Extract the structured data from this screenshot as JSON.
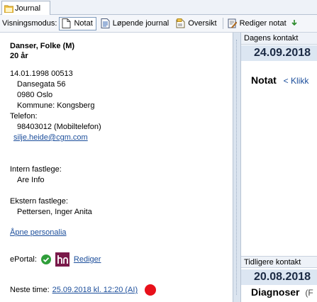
{
  "tab": {
    "label": "Journal",
    "icon": "journal-folder-icon"
  },
  "toolbar": {
    "label": "Visningsmodus:",
    "buttons": [
      {
        "label": "Notat",
        "icon": "document-icon",
        "active": true
      },
      {
        "label": "Løpende journal",
        "icon": "list-document-icon"
      },
      {
        "label": "Oversikt",
        "icon": "overview-icon"
      },
      {
        "label": "Rediger notat",
        "icon": "edit-note-icon"
      }
    ]
  },
  "patient": {
    "name": "Danser, Folke (M)",
    "age": "20 år",
    "birth": "14.01.1998 00513",
    "street": "Dansegata 56",
    "postal": "0980 Oslo",
    "municipality": "Kommune: Kongsberg",
    "phone_label": "Telefon:",
    "phone": "98403012 (Mobiltelefon)",
    "email": "silje.heide@cgm.com",
    "internal_gp_label": "Intern fastlege:",
    "internal_gp": "Are Info",
    "external_gp_label": "Ekstern fastlege:",
    "external_gp": "Pettersen, Inger Anita",
    "open_personalia": "Åpne personalia",
    "eportal_label": "ePortal:",
    "eportal_edit": "Rediger",
    "next_time_label": "Neste time:",
    "next_time": "25.09.2018 kl. 12:20 (AI)",
    "status_color": "#e8101a"
  },
  "right": {
    "todays_contact": "Dagens kontakt",
    "todays_date": "24.09.2018",
    "note_label": "Notat",
    "note_hint": "< Klikk",
    "previous_contact": "Tidligere kontakt",
    "previous_date": "20.08.2018",
    "diagnoses_label": "Diagnoser",
    "diagnoses_hint": "(F"
  }
}
